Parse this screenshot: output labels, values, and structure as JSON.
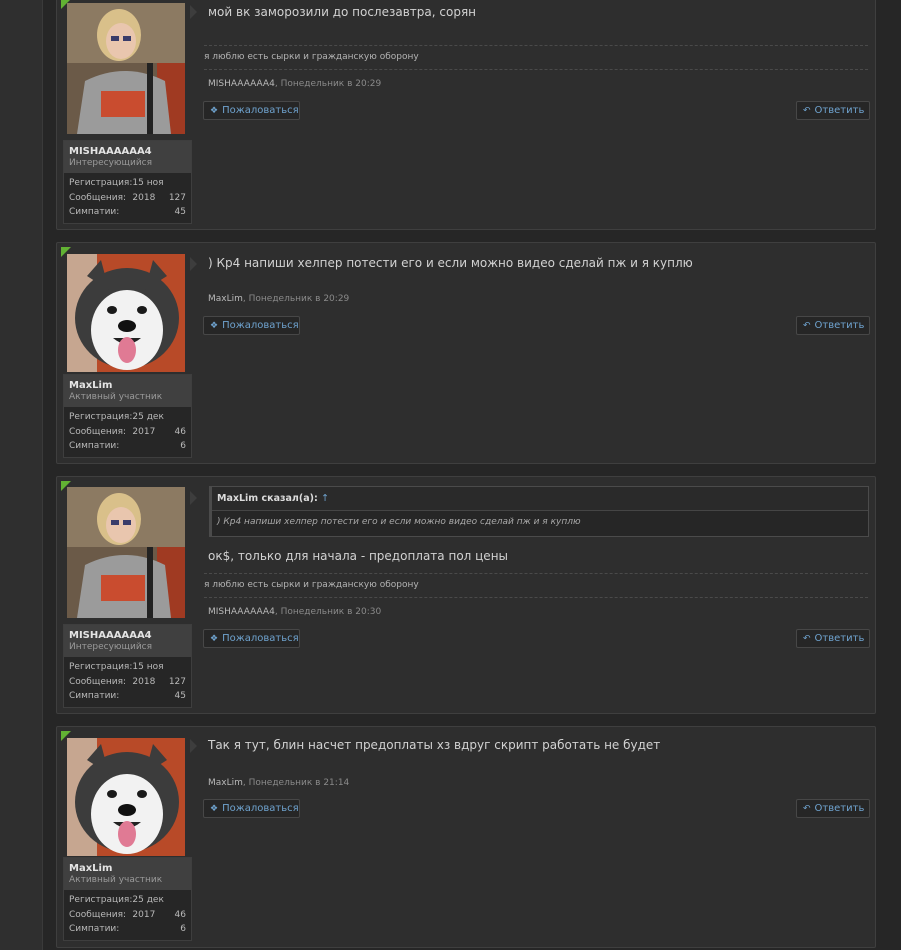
{
  "posts": [
    {
      "author": "MISHAAAAAA4",
      "title": "Интересующийся",
      "stats": [
        {
          "label": "Регистрация:",
          "value": "15 ноя 2018"
        },
        {
          "label": "Сообщения:",
          "value": "127"
        },
        {
          "label": "Симпатии:",
          "value": "45"
        }
      ],
      "message": "мой вк заморозили до послезавтра, сорян",
      "signature": "я люблю есть сырки и гражданскую оборону",
      "time": "Понедельник в 20:29"
    },
    {
      "author": "MaxLim",
      "title": "Активный участник",
      "stats": [
        {
          "label": "Регистрация:",
          "value": "25 дек 2017"
        },
        {
          "label": "Сообщения:",
          "value": "46"
        },
        {
          "label": "Симпатии:",
          "value": "6"
        }
      ],
      "message": ") Кр4 напиши хелпер потести его и если можно видео сделай пж и я куплю",
      "time": "Понедельник в 20:29"
    },
    {
      "author": "MISHAAAAAA4",
      "title": "Интересующийся",
      "stats": [
        {
          "label": "Регистрация:",
          "value": "15 ноя 2018"
        },
        {
          "label": "Сообщения:",
          "value": "127"
        },
        {
          "label": "Симпатии:",
          "value": "45"
        }
      ],
      "quote_head": "MaxLim сказал(а):",
      "quote_up": "↑",
      "quote_text": ") Кр4 напиши хелпер потести его и если можно видео сделай пж и я куплю",
      "message": "ок$, только для начала - предоплата пол цены",
      "signature": "я люблю есть сырки и гражданскую оборону",
      "time": "Понедельник в 20:30"
    },
    {
      "author": "MaxLim",
      "title": "Активный участник",
      "stats": [
        {
          "label": "Регистрация:",
          "value": "25 дек 2017"
        },
        {
          "label": "Сообщения:",
          "value": "46"
        },
        {
          "label": "Симпатии:",
          "value": "6"
        }
      ],
      "message": "Так я тут, блин насчет предоплаты хз вдруг скрипт работать не будет",
      "time": "Понедельник в 21:14"
    }
  ],
  "buttons": {
    "report_label": "Пожаловаться",
    "reply_label": "Ответить",
    "report_icon": "info-circle-icon",
    "reply_icon": "reply-arrow-icon"
  },
  "colors": {
    "accent": "#6fa3cf",
    "new_marker": "#62b233"
  }
}
